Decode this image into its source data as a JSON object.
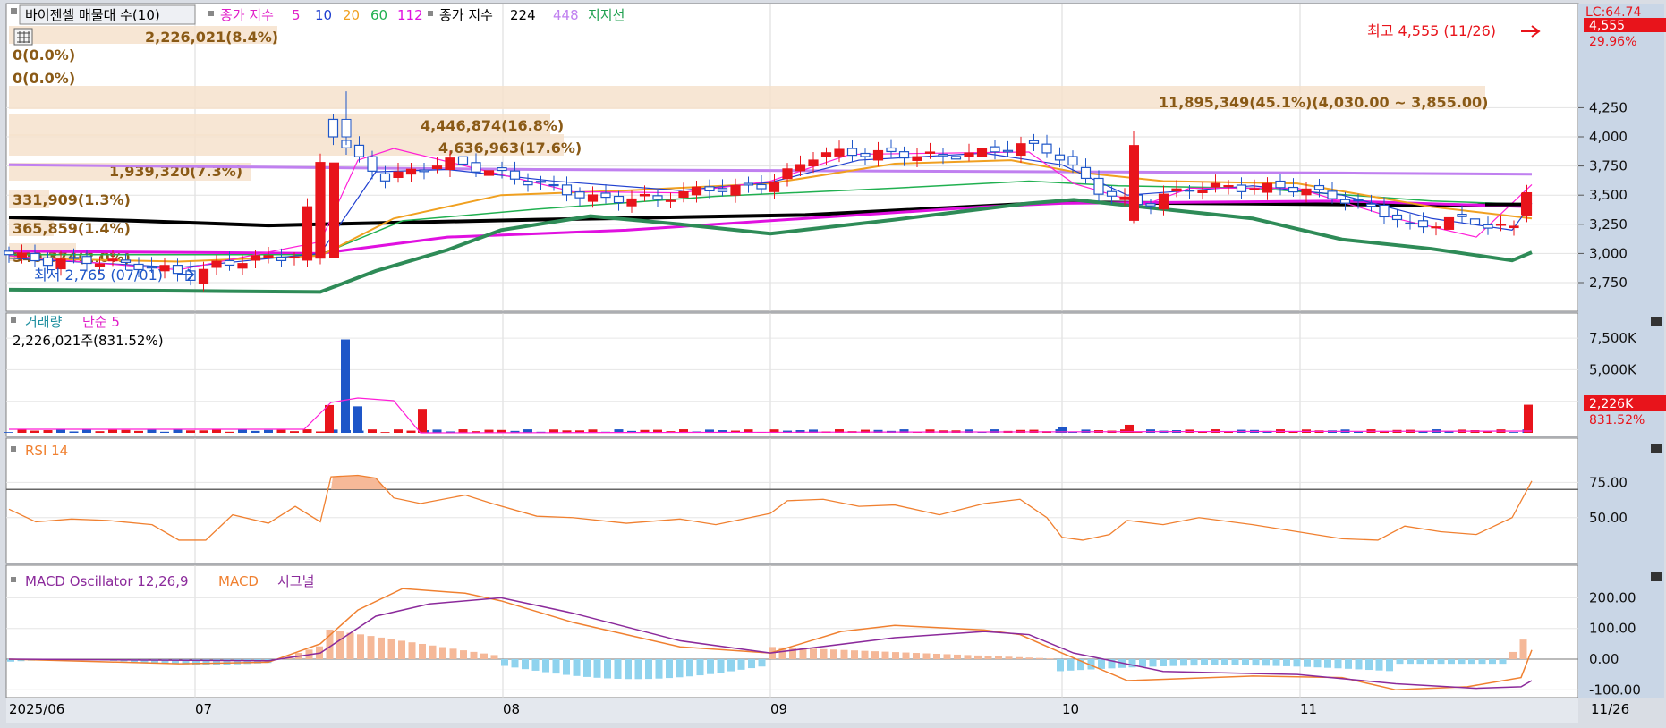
{
  "legend_price": {
    "vp_label": "바이젠셀 매물대 수(10)",
    "ma_title": "종가 지수",
    "ma_periods": [
      "5",
      "10",
      "20",
      "60",
      "112"
    ],
    "ma_title2": "종가 지수",
    "ma_periods2": [
      "224",
      "448"
    ],
    "sr_label": "지지선"
  },
  "legend_volume": {
    "name": "거래량",
    "ma": "단순 5",
    "value": "2,226,021주(831.52%)"
  },
  "legend_rsi": {
    "name": "RSI 14"
  },
  "legend_macd": {
    "osc": "MACD Oscillator 12,26,9",
    "macd": "MACD",
    "signal": "시그널"
  },
  "price_axis": {
    "ticks": [
      "4,250",
      "4,000",
      "3,750",
      "3,500",
      "3,250",
      "3,000",
      "2,750"
    ],
    "top_label": "LC:64.74",
    "current_price": "4,555",
    "current_pct": "29.96%"
  },
  "volume_axis": {
    "ticks": [
      "7,500K",
      "5,000K",
      "2,500K"
    ],
    "current": "2,226K",
    "current_pct": "831.52%"
  },
  "rsi_axis": {
    "ticks": [
      "75.00",
      "50.00"
    ]
  },
  "macd_axis": {
    "ticks": [
      "200.00",
      "100.00",
      "0.00",
      "-100.00"
    ]
  },
  "date_axis": {
    "labels": [
      "2025/06",
      "07",
      "08",
      "09",
      "10",
      "11"
    ],
    "last": "11/26"
  },
  "annotations": {
    "high": "최고 4,555 (11/26)",
    "low": "최저 2,765 (07/01)"
  },
  "volume_profile": [
    {
      "label": "2,226,021(8.4%)",
      "value": 2226021
    },
    {
      "label": "0(0.0%)",
      "value": 0
    },
    {
      "label": "0(0.0%)",
      "value": 0
    },
    {
      "label": "11,895,349(45.1%)(4,030.00 ~ 3,855.00)",
      "value": 11895349
    },
    {
      "label": "4,446,874(16.8%)",
      "value": 4446874
    },
    {
      "label": "4,636,963(17.6%)",
      "value": 4636963
    },
    {
      "label": "1,939,320(7.3%)",
      "value": 1939320
    },
    {
      "label": "331,909(1.3%)",
      "value": 331909
    },
    {
      "label": "365,859(1.4%)",
      "value": 365859
    },
    {
      "label": "540,374(2.0%)",
      "value": 540374
    }
  ],
  "colors": {
    "up": "#e8141b",
    "down": "#1e56c8",
    "ma5": "#ff1ed8",
    "ma10": "#2040d0",
    "ma20": "#f0a020",
    "ma60": "#20b050",
    "ma112": "#e010e0",
    "ma224": "#000000",
    "ma448": "#c080f0",
    "support": "#2e8b57",
    "rsi": "#f08030",
    "macd": "#f08030",
    "signal": "#8b2a9b",
    "osc_pos": "#f5b898",
    "osc_neg": "#8fd3ee"
  },
  "chart_data": {
    "type": "candlestick",
    "date_range": [
      "2025/06",
      "11/26"
    ],
    "price_ylim": [
      2650,
      4500
    ],
    "key_candles": [
      {
        "date": "2025/06/30",
        "open": 2930,
        "high": 3020,
        "low": 2880,
        "close": 2990
      },
      {
        "date": "2025/07/01",
        "open": 2800,
        "high": 2900,
        "low": 2765,
        "close": 2870
      },
      {
        "date": "2025/07/23",
        "open": 2960,
        "high": 3810,
        "low": 2940,
        "close": 3780
      },
      {
        "date": "2025/07/24",
        "open": 4150,
        "high": 4390,
        "low": 3930,
        "close": 4000
      },
      {
        "date": "2025/08/29",
        "open": 3860,
        "high": 3920,
        "low": 3800,
        "close": 3900
      },
      {
        "date": "2025/10/02",
        "open": 3950,
        "high": 4100,
        "low": 3640,
        "close": 3700
      },
      {
        "date": "2025/10/16",
        "open": 3280,
        "high": 3930,
        "low": 3270,
        "close": 3600
      },
      {
        "date": "2025/11/21",
        "open": 3080,
        "high": 3140,
        "low": 3050,
        "close": 3100
      },
      {
        "date": "2025/11/26",
        "open": 3330,
        "high": 3530,
        "low": 3310,
        "close": 3520
      }
    ],
    "rsi": {
      "ylim": [
        20,
        100
      ],
      "level": 70,
      "last": 76
    },
    "macd": {
      "ylim": [
        -120,
        260
      ],
      "last_osc": 100,
      "last_macd": 30,
      "last_signal": -70
    },
    "volume": {
      "ylim": [
        0,
        8500
      ],
      "unit": "K",
      "max_bar": 7400,
      "last": 2226
    }
  }
}
